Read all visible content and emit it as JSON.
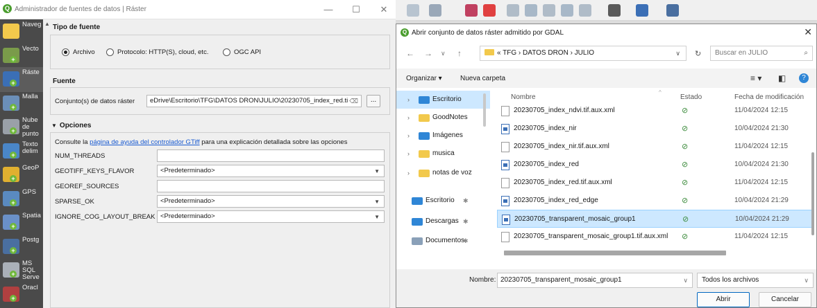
{
  "qgis_window": {
    "title": "Administrador de fuentes de datos | Ráster",
    "controls": {
      "minimize": "—",
      "maximize": "☐",
      "close": "✕"
    }
  },
  "sidebar": {
    "items": [
      {
        "label": "Naveg",
        "color": "#f2c94c"
      },
      {
        "label": "Vecto",
        "color": "#7a9b4a"
      },
      {
        "label": "Ráste",
        "color": "#3b6fb6"
      },
      {
        "label": "Malla",
        "color": "#6b8fb8"
      },
      {
        "label": "Nube\nde\npunto",
        "color": "#9aa0a8"
      },
      {
        "label": "Texto\ndelim",
        "color": "#4a86c8"
      },
      {
        "label": "GeoP",
        "color": "#e0b030"
      },
      {
        "label": "GPS",
        "color": "#5a8ac0"
      },
      {
        "label": "Spatia",
        "color": "#6a90c8"
      },
      {
        "label": "Postg",
        "color": "#4a6fa0"
      },
      {
        "label": "MS\nSQL\nServe",
        "color": "#aab0b8"
      },
      {
        "label": "Oracl",
        "color": "#b04040"
      }
    ]
  },
  "source_type": {
    "title": "Tipo de fuente",
    "options": [
      {
        "label": "Archivo",
        "selected": true
      },
      {
        "label": "Protocolo: HTTP(S), cloud, etc.",
        "selected": false
      },
      {
        "label": "OGC API",
        "selected": false
      }
    ]
  },
  "source": {
    "title": "Fuente",
    "dataset_label": "Conjunto(s) de datos ráster",
    "dataset_value": "eDrive\\Escritorio\\TFG\\DATOS DRON\\JULIO\\20230705_index_red.tif",
    "clear_icon": "⌫",
    "browse_label": "..."
  },
  "options": {
    "title": "Opciones",
    "help_prefix": "Consulte la ",
    "help_link": "página de ayuda del controlador GTiff",
    "help_suffix": " para una explicación detallada sobre las opciones",
    "rows": [
      {
        "label": "NUM_THREADS",
        "value": "",
        "kind": "text"
      },
      {
        "label": "GEOTIFF_KEYS_FLAVOR",
        "value": "<Predeterminado>",
        "kind": "combo"
      },
      {
        "label": "GEOREF_SOURCES",
        "value": "",
        "kind": "text"
      },
      {
        "label": "SPARSE_OK",
        "value": "<Predeterminado>",
        "kind": "combo"
      },
      {
        "label": "IGNORE_COG_LAYOUT_BREAK",
        "value": "<Predeterminado>",
        "kind": "combo"
      }
    ]
  },
  "toolbar_strip": {
    "icons": [
      {
        "name": "label-icon",
        "color": "#b8c4d0"
      },
      {
        "name": "pin-icon",
        "color": "#9aa8b8"
      },
      {
        "name": "label-abc-icon",
        "color": "#c04060"
      },
      {
        "name": "label-abc-red-icon",
        "color": "#e04040"
      },
      {
        "name": "label-tool-1-icon",
        "color": "#b0bcc8"
      },
      {
        "name": "label-tool-2-icon",
        "color": "#a8b8c8"
      },
      {
        "name": "label-tool-3-icon",
        "color": "#b0bcc8"
      },
      {
        "name": "label-tool-4-icon",
        "color": "#a8b8c8"
      },
      {
        "name": "label-tool-5-icon",
        "color": "#b0bcc8"
      },
      {
        "name": "plugin-icon",
        "color": "#5a5a5a"
      },
      {
        "name": "python-icon",
        "color": "#3b6fb6"
      },
      {
        "name": "help-icon",
        "color": "#4a6fa0"
      }
    ]
  },
  "dialog": {
    "title": "Abrir conjunto de datos ráster admitido por GDAL",
    "close": "✕",
    "address": {
      "crumbs": "« TFG  ›  DATOS DRON  ›  JULIO",
      "search_placeholder": "Buscar en JULIO"
    },
    "command_bar": {
      "organize": "Organizar ▾",
      "new_folder": "Nueva carpeta"
    },
    "nav": [
      {
        "label": "Escritorio",
        "expand": "›",
        "color": "#2f86d6",
        "selected": true,
        "pin": ""
      },
      {
        "label": "GoodNotes",
        "expand": "›",
        "color": "#f2c94c",
        "selected": false,
        "pin": ""
      },
      {
        "label": "Imágenes",
        "expand": "›",
        "color": "#2f86d6",
        "selected": false,
        "pin": ""
      },
      {
        "label": "musica",
        "expand": "›",
        "color": "#f2c94c",
        "selected": false,
        "pin": ""
      },
      {
        "label": "notas de voz",
        "expand": "›",
        "color": "#f2c94c",
        "selected": false,
        "pin": ""
      },
      {
        "label": "Escritorio",
        "expand": "",
        "color": "#2f86d6",
        "selected": false,
        "pin": "✱"
      },
      {
        "label": "Descargas",
        "expand": "",
        "color": "#2f86d6",
        "selected": false,
        "pin": "✱"
      },
      {
        "label": "Documentos",
        "expand": "",
        "color": "#8aa0b8",
        "selected": false,
        "pin": "✱"
      }
    ],
    "columns": {
      "name": "Nombre",
      "status": "Estado",
      "date": "Fecha de modificación"
    },
    "files": [
      {
        "name": "20230705_index_ndvi.tif.aux.xml",
        "type": "doc",
        "status": "⊘",
        "date": "11/04/2024 12:15",
        "selected": false
      },
      {
        "name": "20230705_index_nir",
        "type": "img",
        "status": "⊘",
        "date": "10/04/2024 21:30",
        "selected": false
      },
      {
        "name": "20230705_index_nir.tif.aux.xml",
        "type": "doc",
        "status": "⊘",
        "date": "11/04/2024 12:15",
        "selected": false
      },
      {
        "name": "20230705_index_red",
        "type": "img",
        "status": "⊘",
        "date": "10/04/2024 21:30",
        "selected": false
      },
      {
        "name": "20230705_index_red.tif.aux.xml",
        "type": "doc",
        "status": "⊘",
        "date": "11/04/2024 12:15",
        "selected": false
      },
      {
        "name": "20230705_index_red_edge",
        "type": "img",
        "status": "⊘",
        "date": "10/04/2024 21:29",
        "selected": false
      },
      {
        "name": "20230705_transparent_mosaic_group1",
        "type": "img",
        "status": "⊘",
        "date": "10/04/2024 21:29",
        "selected": true
      },
      {
        "name": "20230705_transparent_mosaic_group1.tif.aux.xml",
        "type": "doc",
        "status": "⊘",
        "date": "11/04/2024 12:15",
        "selected": false
      }
    ],
    "footer": {
      "filename_label": "Nombre:",
      "filename_value": "20230705_transparent_mosaic_group1",
      "filter_value": "Todos los archivos",
      "open_label": "Abrir",
      "cancel_label": "Cancelar"
    }
  }
}
